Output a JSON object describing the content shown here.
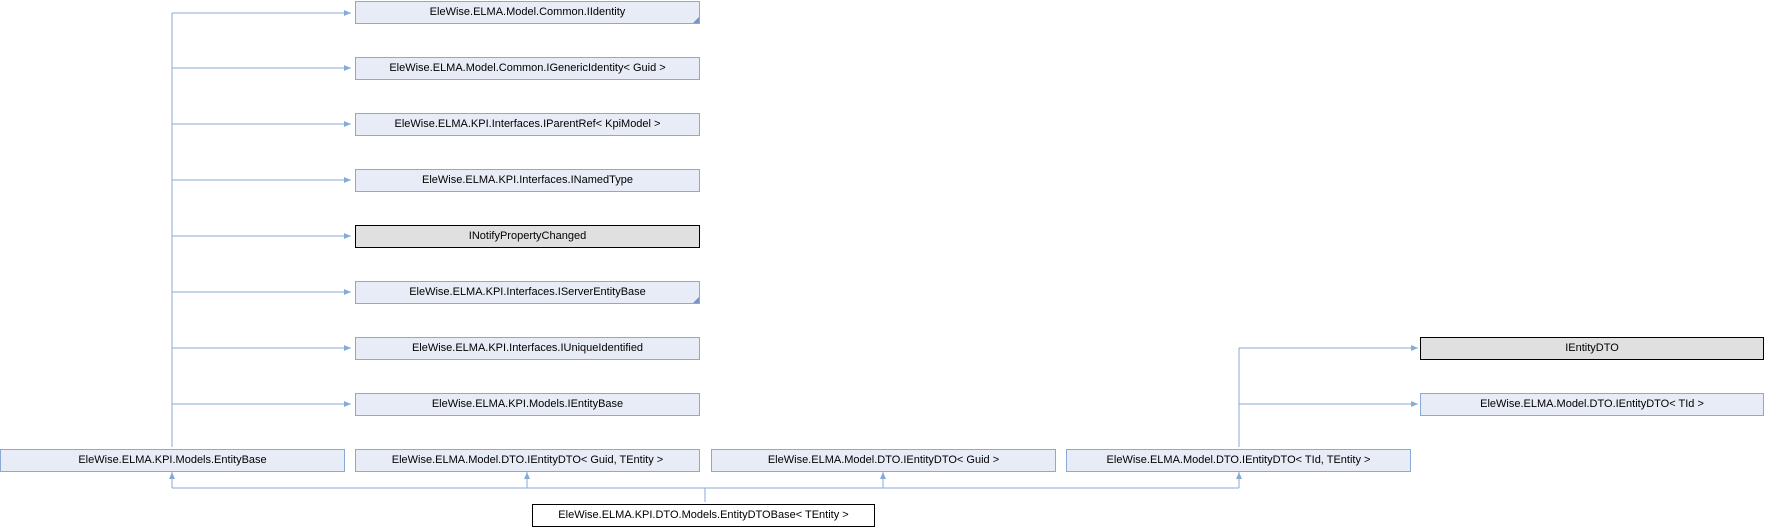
{
  "diagram": {
    "nodes": {
      "iidentity": "EleWise.ELMA.Model.Common.IIdentity",
      "igeneric_identity": "EleWise.ELMA.Model.Common.IGenericIdentity< Guid >",
      "iparentref": "EleWise.ELMA.KPI.Interfaces.IParentRef< KpiModel >",
      "inamedtype": "EleWise.ELMA.KPI.Interfaces.INamedType",
      "inotify": "INotifyPropertyChanged",
      "iserverentitybase": "EleWise.ELMA.KPI.Interfaces.IServerEntityBase",
      "iuniqueidentified": "EleWise.ELMA.KPI.Interfaces.IUniqueIdentified",
      "ientitybase": "EleWise.ELMA.KPI.Models.IEntityBase",
      "ientitydto_plain": "IEntityDTO",
      "ientitydto_tid": "EleWise.ELMA.Model.DTO.IEntityDTO< TId >",
      "entitybase": "EleWise.ELMA.KPI.Models.EntityBase",
      "ientitydto_guid_tentity": "EleWise.ELMA.Model.DTO.IEntityDTO< Guid, TEntity >",
      "ientitydto_guid": "EleWise.ELMA.Model.DTO.IEntityDTO< Guid >",
      "ientitydto_tid_tentity": "EleWise.ELMA.Model.DTO.IEntityDTO< TId, TEntity >",
      "entitydtobase": "EleWise.ELMA.KPI.DTO.Models.EntityDTOBase< TEntity >"
    },
    "colors": {
      "edge": "#8aaad6",
      "interface_fill": "#e8ecf6",
      "external_fill": "#e0e0e0"
    }
  }
}
